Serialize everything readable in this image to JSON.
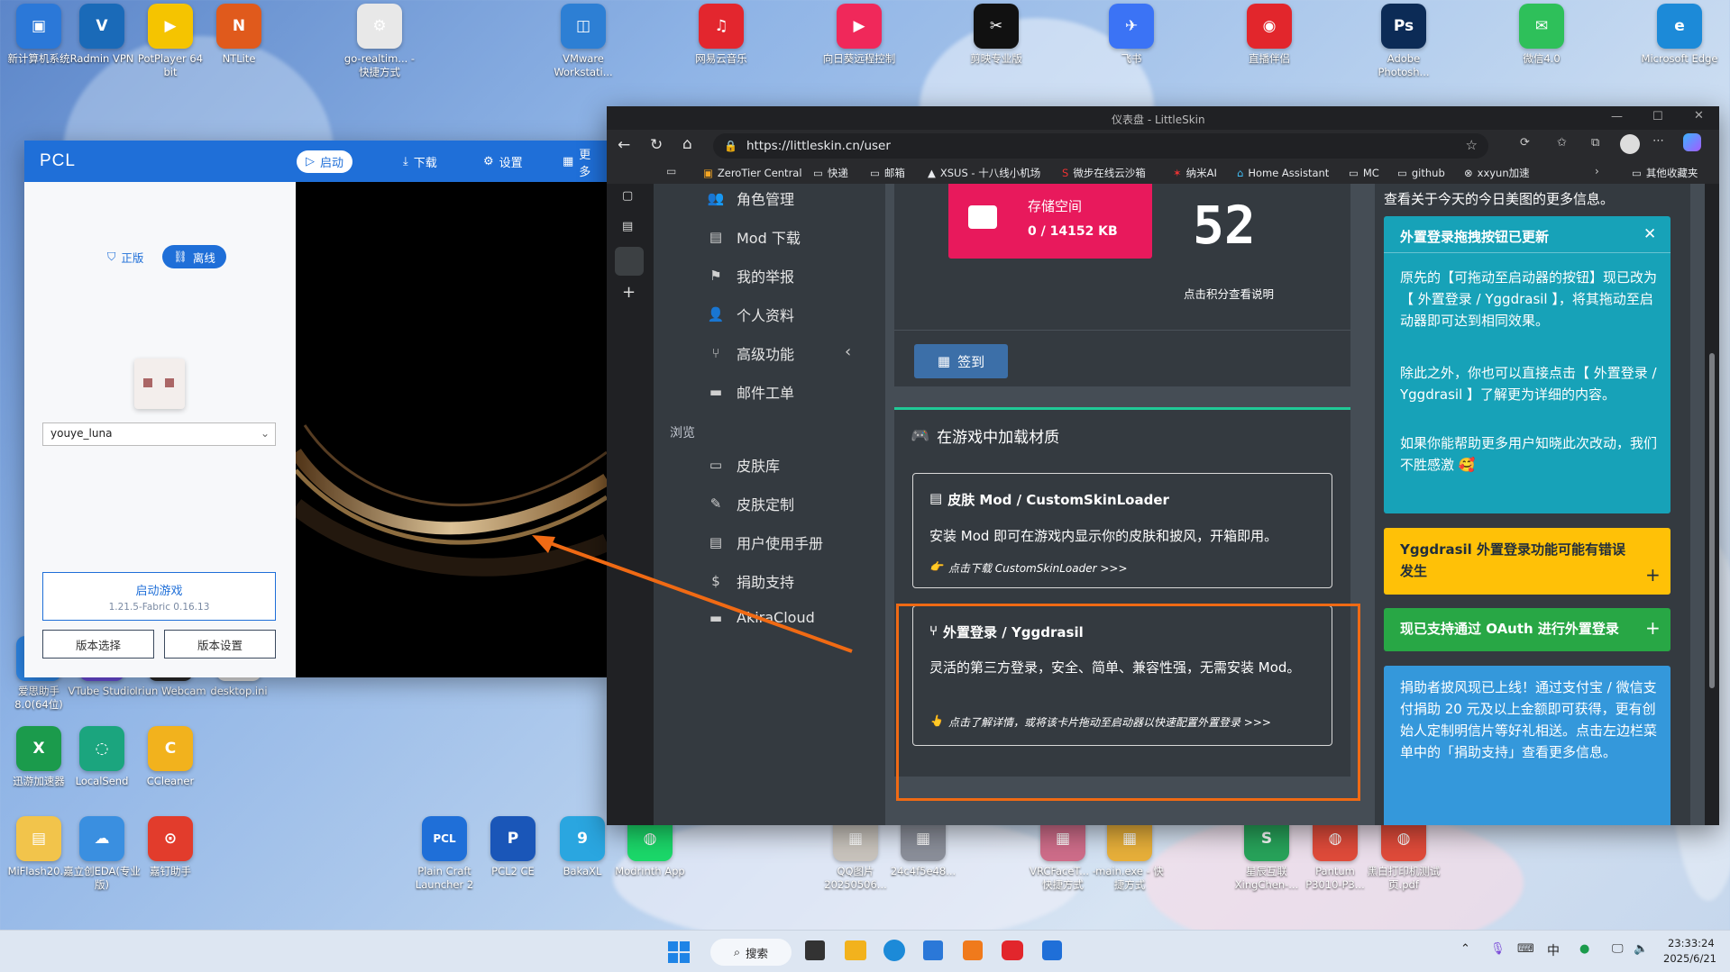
{
  "desktop": {
    "icons": [
      {
        "label": "新计算机系统",
        "color": "#2b78d8",
        "glyph": "▣"
      },
      {
        "label": "Radmin VPN",
        "color": "#1a6ab8",
        "glyph": "V"
      },
      {
        "label": "PotPlayer 64 bit",
        "color": "#f5c400",
        "glyph": "▶"
      },
      {
        "label": "NTLite",
        "color": "#e05a1c",
        "glyph": "N"
      },
      {
        "label": "go-realtim... - 快捷方式",
        "color": "#e8e8e8",
        "glyph": "⚙"
      },
      {
        "label": "VMware Workstati...",
        "color": "#2d7fd4",
        "glyph": "◫"
      },
      {
        "label": "网易云音乐",
        "color": "#e3262e",
        "glyph": "♫"
      },
      {
        "label": "向日葵远程控制",
        "color": "#f0285a",
        "glyph": "▶"
      },
      {
        "label": "剪映专业版",
        "color": "#111111",
        "glyph": "✂"
      },
      {
        "label": "飞书",
        "color": "#3b73f5",
        "glyph": "✈"
      },
      {
        "label": "直播伴侣",
        "color": "#e2262c",
        "glyph": "◉"
      },
      {
        "label": "Adobe Photosh...",
        "color": "#0c2b56",
        "glyph": "Ps"
      },
      {
        "label": "微信4.0",
        "color": "#2ec05a",
        "glyph": "✉"
      },
      {
        "label": "Microsoft Edge",
        "color": "#1c8ad8",
        "glyph": "e"
      },
      {
        "label": "爱思助手 8.0(64位)",
        "color": "#2d86e6",
        "glyph": "i"
      },
      {
        "label": "VTube Studio",
        "color": "#6a4bd8",
        "glyph": "V"
      },
      {
        "label": "Iriun Webcam",
        "color": "#2a2a2a",
        "glyph": "◎"
      },
      {
        "label": "desktop.ini",
        "color": "#dddddd",
        "glyph": "≡"
      },
      {
        "label": "迅游加速器",
        "color": "#1b9b4c",
        "glyph": "X"
      },
      {
        "label": "LocalSend",
        "color": "#1ba57e",
        "glyph": "◌"
      },
      {
        "label": "CCleaner",
        "color": "#f2b21d",
        "glyph": "C"
      },
      {
        "label": "MiFlash20...",
        "color": "#f2c44b",
        "glyph": "▤"
      },
      {
        "label": "嘉立创EDA(专业版)",
        "color": "#3a8fe0",
        "glyph": "☁"
      },
      {
        "label": "嘉钉助手",
        "color": "#e23c2c",
        "glyph": "⊙"
      },
      {
        "label": "Plain Craft Launcher 2",
        "color": "#1f6fd8",
        "glyph": "PCL"
      },
      {
        "label": "PCL2 CE",
        "color": "#1a56b8",
        "glyph": "P"
      },
      {
        "label": "BakaXL",
        "color": "#2aa6e0",
        "glyph": "9"
      },
      {
        "label": "Modrinth App",
        "color": "#1bd96a",
        "glyph": "◍"
      },
      {
        "label": "QQ图片 20250506...",
        "color": "#c9c4bd",
        "glyph": "▦"
      },
      {
        "label": "24c4f5e48...",
        "color": "#8b8f9a",
        "glyph": "▦"
      },
      {
        "label": "VRCFaceT... - 快捷方式",
        "color": "#cf6d8a",
        "glyph": "▦"
      },
      {
        "label": "main.exe - 快捷方式",
        "color": "#e8b03a",
        "glyph": "▦"
      },
      {
        "label": "星辰互联 XingChen-...",
        "color": "#27a35a",
        "glyph": "S"
      },
      {
        "label": "Pantum P3010-P3...",
        "color": "#e04b3a",
        "glyph": "◍"
      },
      {
        "label": "黑白打印机测试页.pdf",
        "color": "#e04b3a",
        "glyph": "◍"
      }
    ]
  },
  "pcl": {
    "title": "PCL",
    "nav": [
      "启动",
      "下载",
      "设置",
      "更多"
    ],
    "mode_official": "正版",
    "mode_offline": "离线",
    "username": "youye_luna",
    "launch_label": "启动游戏",
    "launch_version": "1.21.5-Fabric 0.16.13",
    "version_select": "版本选择",
    "version_settings": "版本设置"
  },
  "browser": {
    "tab_title": "仪表盘 - LittleSkin",
    "url": "https://littleskin.cn/user",
    "bookmarks": [
      "ZeroTier Central",
      "快递",
      "邮箱",
      "XSUS - 十八线小机场",
      "微步在线云沙箱",
      "纳米AI",
      "Home Assistant",
      "MC",
      "github",
      "xxyun加速"
    ],
    "other_bookmarks": "其他收藏夹",
    "sidebar": {
      "items": [
        "角色管理",
        "Mod 下载",
        "我的举报",
        "个人资料",
        "高级功能",
        "邮件工单"
      ],
      "section": "浏览",
      "browse": [
        "皮肤库",
        "皮肤定制",
        "用户使用手册",
        "捐助支持",
        "AkiraCloud"
      ]
    },
    "storage": {
      "label": "存储空间",
      "value": "0 / 14152 KB"
    },
    "score": {
      "value": "52",
      "hint": "点击积分查看说明"
    },
    "sign_button": "签到",
    "load": {
      "title": "在游戏中加载材质",
      "card1": {
        "title": "皮肤 Mod / CustomSkinLoader",
        "body": "安装 Mod 即可在游戏内显示你的皮肤和披风，开箱即用。",
        "link": "点击下载 CustomSkinLoader >>>"
      },
      "card2": {
        "title": "外置登录 / Yggdrasil",
        "body": "灵活的第三方登录，安全、简单、兼容性强，无需安装 Mod。",
        "link": "点击了解详情，或将该卡片拖动至启动器以快速配置外置登录 >>>"
      }
    },
    "right": {
      "top": "查看关于今天的今日美图的更多信息。",
      "notice_title": "外置登录拖拽按钮已更新",
      "notice_p1": "原先的【可拖动至启动器的按钮】现已改为【 外置登录 / Yggdrasil 】，将其拖动至启动器即可达到相同效果。",
      "notice_p2": "除此之外，你也可以直接点击【 外置登录 / Yggdrasil 】了解更为详细的内容。",
      "notice_p3": "如果你能帮助更多用户知晓此次改动，我们不胜感激 🥰",
      "yellow": "Yggdrasil 外置登录功能可能有错误发生",
      "green": "现已支持通过 OAuth 进行外置登录",
      "blue": "捐助者披风现已上线！通过支付宝 / 微信支付捐助 20 元及以上金额即可获得，更有创始人定制明信片等好礼相送。点击左边栏菜单中的「捐助支持」查看更多信息。"
    }
  },
  "taskbar": {
    "search": "搜索",
    "ime": "中",
    "time": "23:33:24",
    "date": "2025/6/21"
  },
  "colors": {
    "pcl_blue": "#1f6fd8",
    "storage_pink": "#e8195c",
    "teal": "#17a2b8",
    "yellow": "#ffc107",
    "green": "#28a745",
    "blue": "#3498db",
    "highlight": "#f06a14"
  }
}
